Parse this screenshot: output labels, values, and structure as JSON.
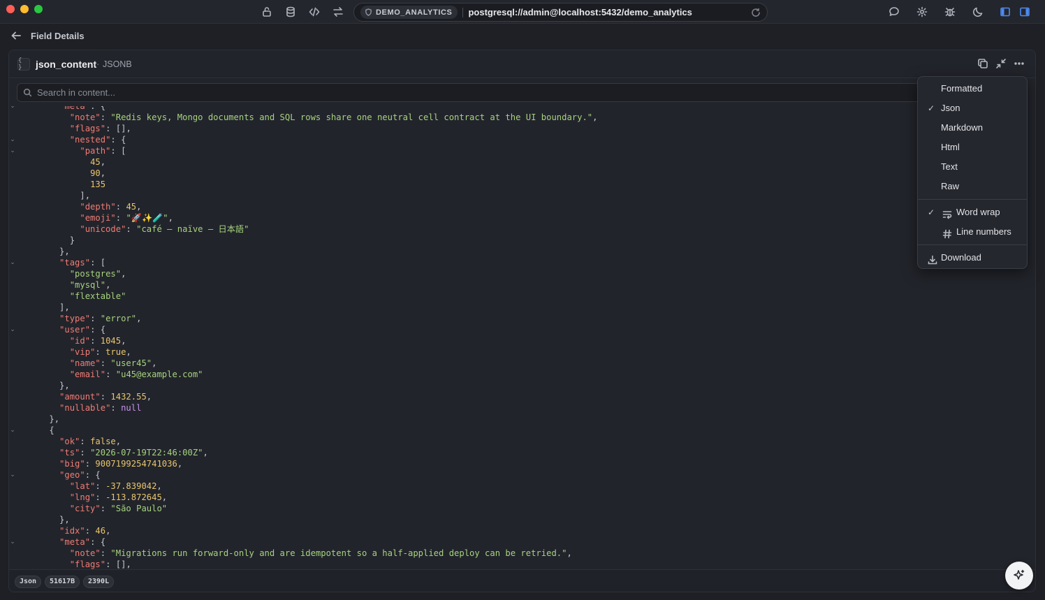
{
  "titlebar": {
    "db_name": "DEMO_ANALYTICS",
    "connection_url": "postgresql://admin@localhost:5432/demo_analytics"
  },
  "header": {
    "title": "Field Details"
  },
  "field": {
    "name": "json_content",
    "separator": "·",
    "type": "JSONB"
  },
  "search": {
    "placeholder": "Search in content..."
  },
  "menu": {
    "formats": [
      "Formatted",
      "Json",
      "Markdown",
      "Html",
      "Text",
      "Raw"
    ],
    "selected_format": "Json",
    "word_wrap": "Word wrap",
    "line_numbers": "Line numbers",
    "download": "Download"
  },
  "code_lines": [
    {
      "t": "      \"meta\": {",
      "fold": true
    },
    {
      "t": "        \"note\": \"Redis keys, Mongo documents and SQL rows share one neutral cell contract at the UI boundary.\","
    },
    {
      "t": "        \"flags\": [],"
    },
    {
      "t": "        \"nested\": {",
      "fold": true
    },
    {
      "t": "          \"path\": [",
      "fold": true
    },
    {
      "t": "            45,"
    },
    {
      "t": "            90,"
    },
    {
      "t": "            135"
    },
    {
      "t": "          ],"
    },
    {
      "t": "          \"depth\": 45,"
    },
    {
      "t": "          \"emoji\": \"🚀✨🧪\","
    },
    {
      "t": "          \"unicode\": \"café — naïve — 日本語\""
    },
    {
      "t": "        }"
    },
    {
      "t": "      },"
    },
    {
      "t": "      \"tags\": [",
      "fold": true
    },
    {
      "t": "        \"postgres\","
    },
    {
      "t": "        \"mysql\","
    },
    {
      "t": "        \"flextable\""
    },
    {
      "t": "      ],"
    },
    {
      "t": "      \"type\": \"error\","
    },
    {
      "t": "      \"user\": {",
      "fold": true
    },
    {
      "t": "        \"id\": 1045,"
    },
    {
      "t": "        \"vip\": true,"
    },
    {
      "t": "        \"name\": \"user45\","
    },
    {
      "t": "        \"email\": \"u45@example.com\""
    },
    {
      "t": "      },"
    },
    {
      "t": "      \"amount\": 1432.55,"
    },
    {
      "t": "      \"nullable\": null"
    },
    {
      "t": "    },"
    },
    {
      "t": "    {",
      "fold": true
    },
    {
      "t": "      \"ok\": false,"
    },
    {
      "t": "      \"ts\": \"2026-07-19T22:46:00Z\","
    },
    {
      "t": "      \"big\": 9007199254741036,"
    },
    {
      "t": "      \"geo\": {",
      "fold": true
    },
    {
      "t": "        \"lat\": -37.839042,"
    },
    {
      "t": "        \"lng\": -113.872645,"
    },
    {
      "t": "        \"city\": \"São Paulo\""
    },
    {
      "t": "      },"
    },
    {
      "t": "      \"idx\": 46,"
    },
    {
      "t": "      \"meta\": {",
      "fold": true
    },
    {
      "t": "        \"note\": \"Migrations run forward-only and are idempotent so a half-applied deploy can be retried.\","
    },
    {
      "t": "        \"flags\": [],"
    }
  ],
  "footer": {
    "format": "Json",
    "size": "51617B",
    "lines": "2390L"
  },
  "colors": {
    "key": "#f07c74",
    "string": "#a6d37f",
    "number": "#e8c66e",
    "null": "#c792ea",
    "accent": "#4d8bf5"
  }
}
